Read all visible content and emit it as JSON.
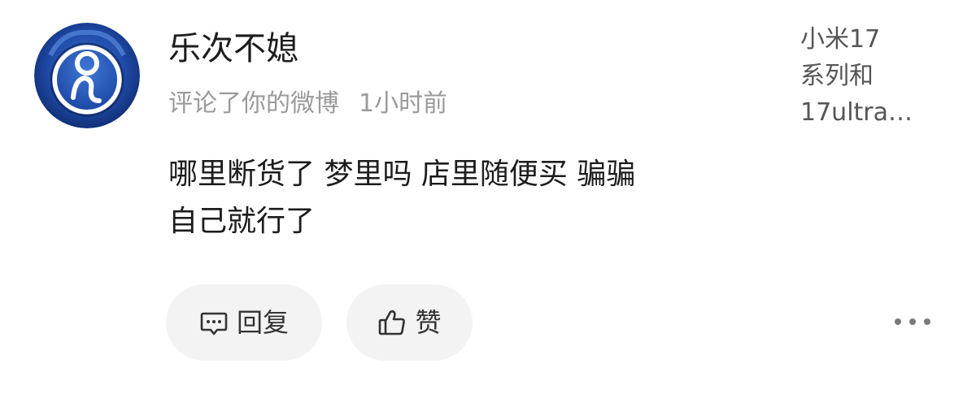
{
  "comment": {
    "avatar_icon": "team-logo-icon",
    "username": "乐次不媳",
    "action": "评论了你的微博",
    "time": "1小时前",
    "content_lines": [
      "哪里断货了 梦里吗 店里随便买 骗骗",
      "自己就行了"
    ]
  },
  "original_post": {
    "title_lines": [
      "小米17",
      "系列和",
      "17ultra…"
    ]
  },
  "actions": {
    "reply_label": "回复",
    "like_label": "赞",
    "reply_icon": "comment-icon",
    "like_icon": "thumbs-up-icon",
    "more_icon": "more-icon"
  },
  "colors": {
    "background": "#ffffff",
    "text_primary": "#1c1c1c",
    "text_secondary": "#9a9a9a",
    "pill_background": "#f3f3f3",
    "avatar_primary": "#1e3f97"
  }
}
